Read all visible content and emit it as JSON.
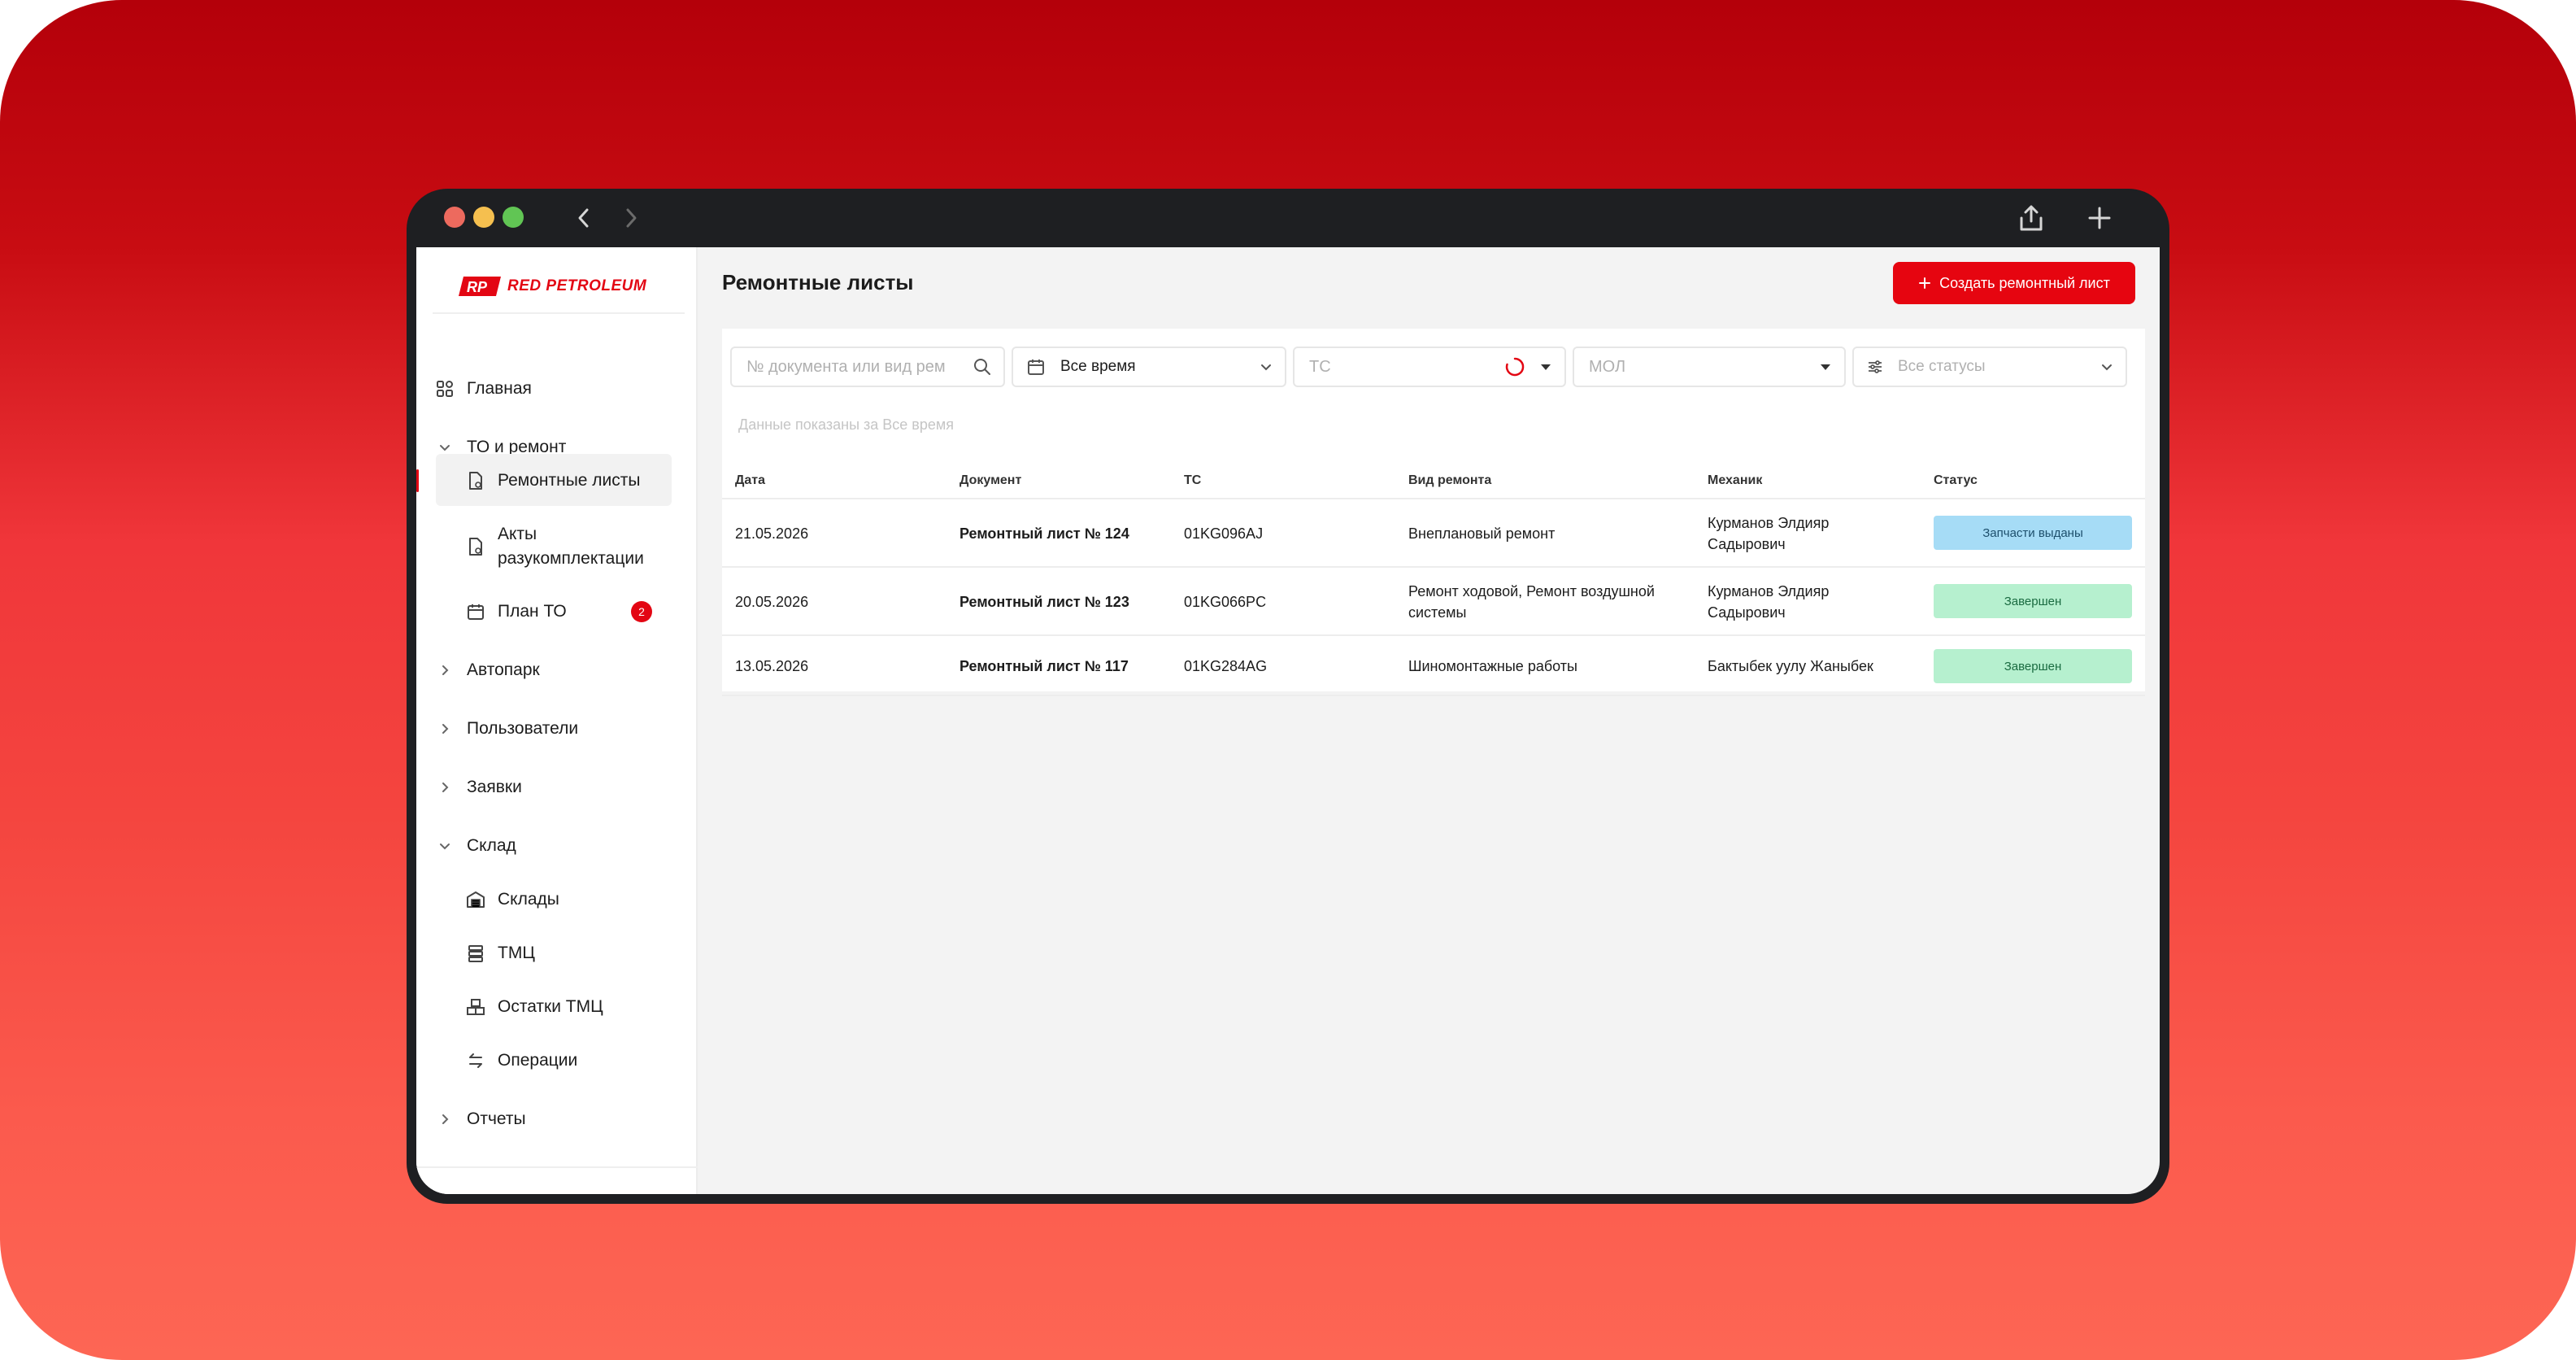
{
  "brand": {
    "logo_mark": "RP",
    "logo_text": "RED PETROLEUM"
  },
  "sidebar": {
    "items": [
      {
        "label": "Главная",
        "icon": "grid-icon"
      },
      {
        "label": "ТО и ремонт",
        "icon": "chevron-down-icon"
      },
      {
        "label": "Ремонтные листы",
        "icon": "document-icon",
        "active": true
      },
      {
        "label": "Акты разукомплектации",
        "icon": "document-icon"
      },
      {
        "label": "План ТО",
        "icon": "calendar-icon",
        "badge": "2"
      },
      {
        "label": "Автопарк",
        "icon": "chevron-right-icon"
      },
      {
        "label": "Пользователи",
        "icon": "chevron-right-icon"
      },
      {
        "label": "Заявки",
        "icon": "chevron-right-icon"
      },
      {
        "label": "Склад",
        "icon": "chevron-down-icon"
      },
      {
        "label": "Склады",
        "icon": "warehouse-icon"
      },
      {
        "label": "ТМЦ",
        "icon": "database-icon"
      },
      {
        "label": "Остатки ТМЦ",
        "icon": "boxes-icon"
      },
      {
        "label": "Операции",
        "icon": "swap-icon"
      },
      {
        "label": "Отчеты",
        "icon": "chevron-right-icon"
      }
    ]
  },
  "page": {
    "title": "Ремонтные листы",
    "create_button": "Создать ремонтный лист"
  },
  "filters": {
    "search_placeholder": "№ документа или вид рем",
    "period_value": "Все время",
    "vehicle_placeholder": "ТС",
    "mol_placeholder": "МОЛ",
    "status_placeholder": "Все статусы",
    "hint": "Данные показаны за Все время"
  },
  "table": {
    "columns": [
      "Дата",
      "Документ",
      "ТС",
      "Вид ремонта",
      "Механик",
      "Статус"
    ],
    "rows": [
      {
        "date": "21.05.2026",
        "doc": "Ремонтный лист № 124",
        "ts": "01KG096AJ",
        "type": "Внеплановый ремонт",
        "mechanic": "Курманов Элдияр Садырович",
        "status": "Запчасти выданы",
        "status_color": "#a6dcf6"
      },
      {
        "date": "20.05.2026",
        "doc": "Ремонтный лист № 123",
        "ts": "01KG066PC",
        "type": "Ремонт ходовой, Ремонт воздушной системы",
        "mechanic": "Курманов Элдияр Садырович",
        "status": "Завершен",
        "status_color": "#b6f0cf"
      },
      {
        "date": "13.05.2026",
        "doc": "Ремонтный лист № 117",
        "ts": "01KG284AG",
        "type": "Шиномонтажные работы",
        "mechanic": "Бактыбек уулу Жаныбек",
        "status": "Завершен",
        "status_color": "#b6f0cf"
      }
    ]
  },
  "colors": {
    "accent": "#e30613",
    "background_top": "#b4000a",
    "background_bottom": "#fd6654"
  }
}
